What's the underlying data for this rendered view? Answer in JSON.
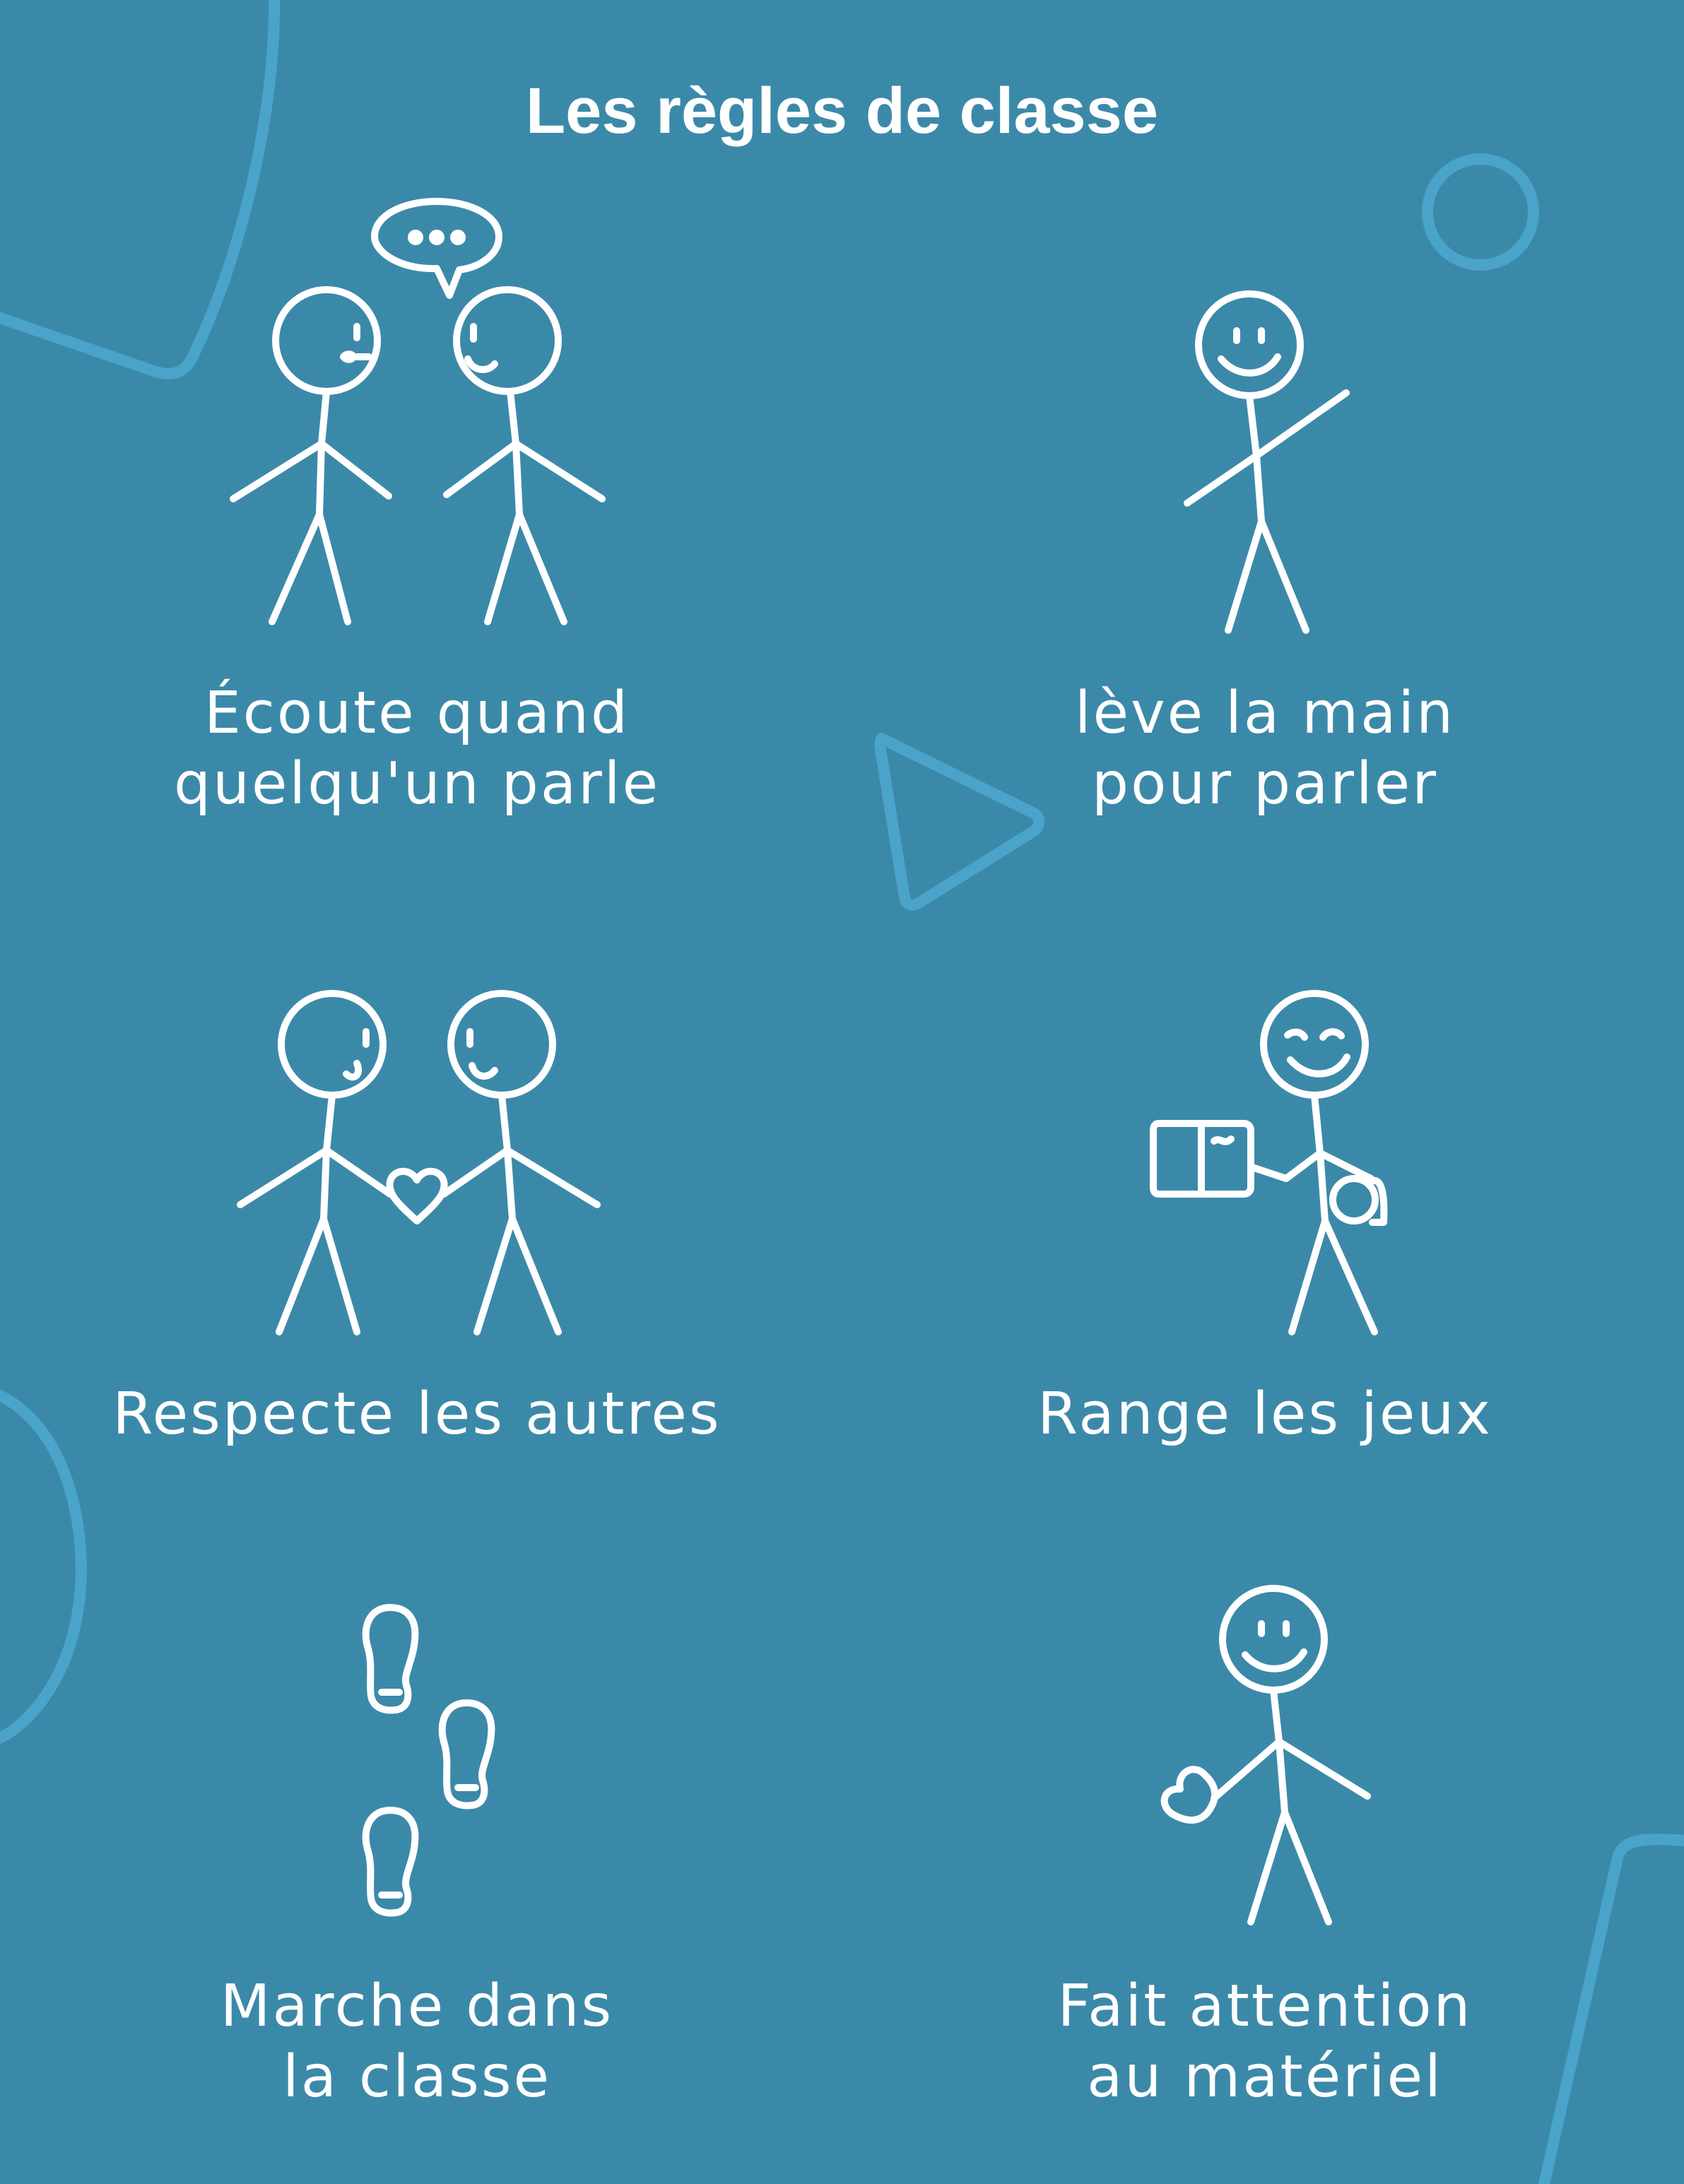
{
  "title": "Les règles de classe",
  "colors": {
    "background": "#3b89a9",
    "decoration": "#4aa3c9",
    "foreground": "#ffffff"
  },
  "rules": [
    {
      "icon": "two-people-talking-icon",
      "lines": [
        "Écoute quand",
        "quelqu'un parle"
      ]
    },
    {
      "icon": "person-raising-hand-icon",
      "lines": [
        "lève la main",
        "pour parler"
      ]
    },
    {
      "icon": "two-people-heart-icon",
      "lines": [
        "Respecte les autres"
      ]
    },
    {
      "icon": "person-holding-book-icon",
      "lines": [
        "Range les jeux"
      ]
    },
    {
      "icon": "footprints-icon",
      "lines": [
        "Marche dans",
        "la classe"
      ]
    },
    {
      "icon": "person-holding-heart-icon",
      "lines": [
        "Fait attention",
        "au matériel"
      ]
    }
  ]
}
